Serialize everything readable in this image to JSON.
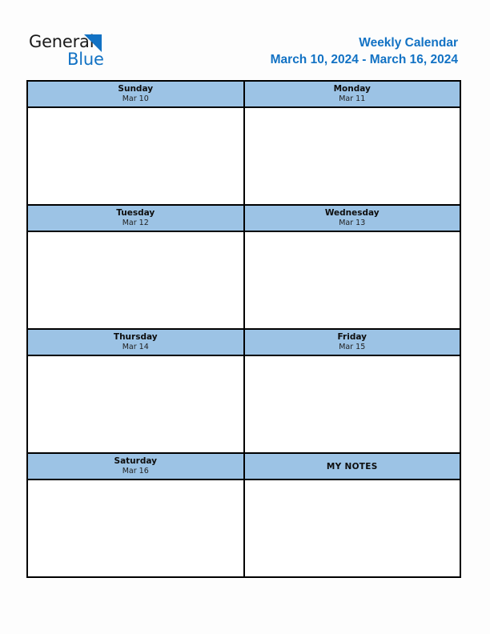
{
  "logo": {
    "word_one": "General",
    "word_two": "Blue",
    "triangle_color": "#1272C4",
    "text_color": "#1A1A1A"
  },
  "header": {
    "title": "Weekly Calendar",
    "date_range": "March 10, 2024 - March 16, 2024",
    "accent_color": "#1272C4"
  },
  "theme": {
    "header_cell_bg": "#9CC3E5",
    "border_color": "#000000",
    "page_bg": "#FDFDFD",
    "cell_bg": "#FFFFFF"
  },
  "calendar": {
    "rows": [
      {
        "cells": [
          {
            "day": "Sunday",
            "date": "Mar 10",
            "content": ""
          },
          {
            "day": "Monday",
            "date": "Mar 11",
            "content": ""
          }
        ]
      },
      {
        "cells": [
          {
            "day": "Tuesday",
            "date": "Mar 12",
            "content": ""
          },
          {
            "day": "Wednesday",
            "date": "Mar 13",
            "content": ""
          }
        ]
      },
      {
        "cells": [
          {
            "day": "Thursday",
            "date": "Mar 14",
            "content": ""
          },
          {
            "day": "Friday",
            "date": "Mar 15",
            "content": ""
          }
        ]
      },
      {
        "cells": [
          {
            "day": "Saturday",
            "date": "Mar 16",
            "content": ""
          },
          {
            "day": "MY NOTES",
            "date": "",
            "content": ""
          }
        ]
      }
    ]
  }
}
